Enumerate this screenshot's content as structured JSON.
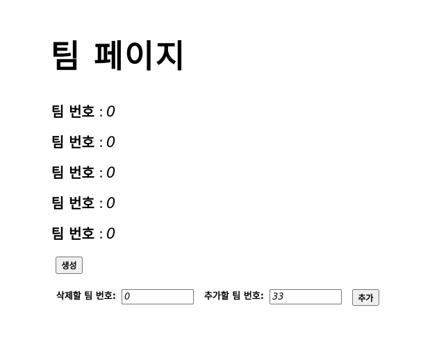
{
  "header": {
    "title": "팀 페이지"
  },
  "teams": [
    {
      "label": "팀 번호",
      "separator": ":",
      "value": "0"
    },
    {
      "label": "팀 번호",
      "separator": ":",
      "value": "0"
    },
    {
      "label": "팀 번호",
      "separator": ":",
      "value": "0"
    },
    {
      "label": "팀 번호",
      "separator": ":",
      "value": "0"
    },
    {
      "label": "팀 번호",
      "separator": ":",
      "value": "0"
    }
  ],
  "actions": {
    "create_label": "생성"
  },
  "form": {
    "delete_label": "삭제할 팀 번호:",
    "delete_value": "0",
    "add_label": "추가할 팀 번호:",
    "add_value": "33",
    "add_button_label": "추가"
  }
}
